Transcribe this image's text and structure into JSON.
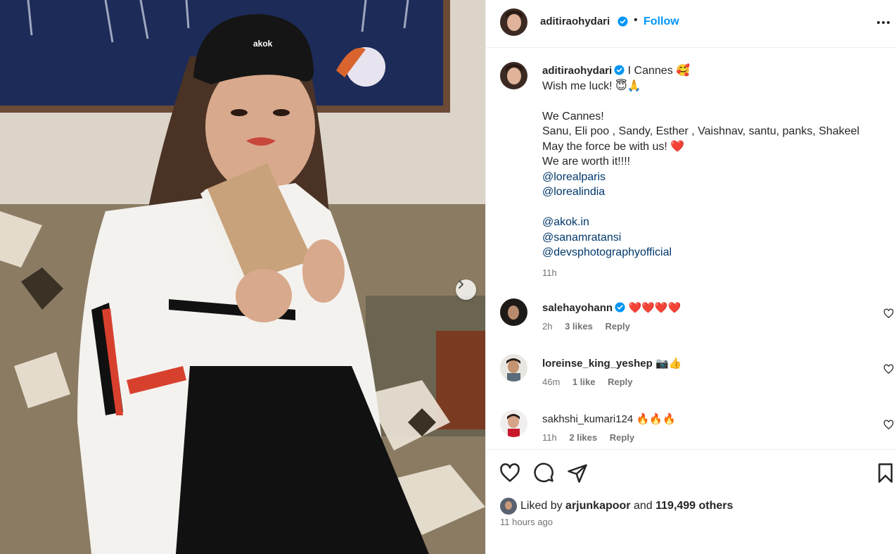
{
  "header": {
    "username": "aditiraohydari",
    "follow_label": "Follow",
    "separator": "•"
  },
  "caption": {
    "username": "aditiraohydari",
    "lines": [
      "I Cannes 🥰",
      "Wish me luck! 😇🙏",
      "",
      "We Cannes!",
      "Sanu, Eli poo , Sandy, Esther , Vaishnav, santu, panks, Shakeel",
      "May the force be with us! ❤️",
      "We are worth it!!!!"
    ],
    "mentions": [
      "@lorealparis",
      "@lorealindia",
      "@akok.in",
      "@sanamratansi",
      "@devsphotographyofficial"
    ],
    "time": "11h"
  },
  "comments": [
    {
      "username": "salehayohann",
      "verified": true,
      "text": "❤️❤️❤️❤️",
      "time": "2h",
      "likes": "3 likes",
      "reply": "Reply"
    },
    {
      "username": "loreinse_king_yeshep",
      "verified": false,
      "text": "📷👍",
      "time": "46m",
      "likes": "1 like",
      "reply": "Reply"
    },
    {
      "username": "sakhshi_kumari124",
      "verified": false,
      "text": "🔥🔥🔥",
      "time": "11h",
      "likes": "2 likes",
      "reply": "Reply"
    }
  ],
  "likes": {
    "prefix": "Liked by",
    "user": "arjunkapoor",
    "conj": "and",
    "others": "119,499 others"
  },
  "posted_ago": "11 hours ago",
  "photo": {
    "cap_text": "akok"
  },
  "colors": {
    "accent": "#0095f6",
    "mention": "#00376b",
    "verified": "#0095f6"
  }
}
